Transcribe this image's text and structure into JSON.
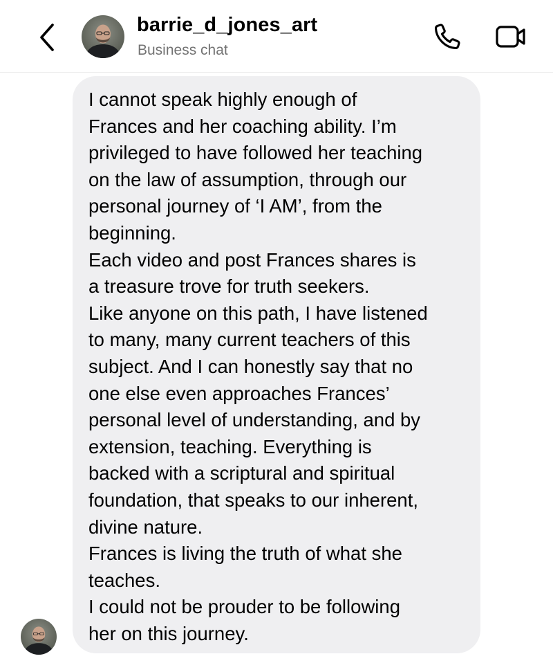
{
  "header": {
    "back_icon": "chevron-left-icon",
    "username": "barrie_d_jones_art",
    "subtitle": "Business chat",
    "call_icon": "phone-icon",
    "video_icon": "video-camera-icon"
  },
  "message": {
    "lines": [
      "I cannot speak highly enough of",
      "Frances and her coaching ability. I’m",
      "privileged to have followed her teaching",
      "on the law of assumption, through our",
      "personal journey of ‘I AM’, from the",
      "beginning.",
      "Each video and post Frances shares is",
      "a treasure trove for truth seekers.",
      "Like anyone on this path, I have listened",
      "to many, many current teachers of this",
      "subject. And I can honestly say that no",
      "one else even approaches Frances’",
      "personal level of understanding, and by",
      "extension, teaching. Everything is",
      "backed with a scriptural and spiritual",
      "foundation, that speaks to our inherent,",
      "divine nature.",
      "Frances is living the truth of what she",
      "teaches.",
      "I could not be prouder to be following",
      "her on this journey."
    ]
  },
  "colors": {
    "bubble_background": "#efeff1",
    "subtitle_text": "#737373",
    "divider": "#ececec"
  }
}
